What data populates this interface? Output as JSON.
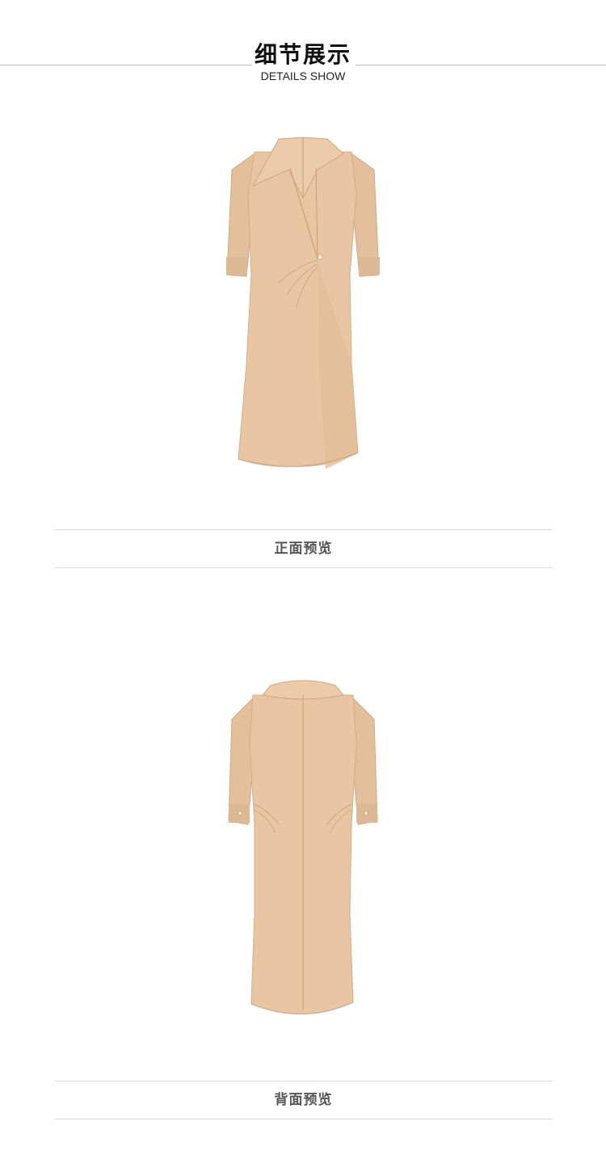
{
  "header": {
    "title": "细节展示",
    "subtitle": "DETAILS SHOW"
  },
  "sections": [
    {
      "image_subject": "dress-front-view",
      "caption": "正面预览"
    },
    {
      "image_subject": "dress-back-view",
      "caption": "背面预览"
    }
  ],
  "colors": {
    "dress_fabric": "#e6c3a0",
    "dress_shadow": "#d2aa85",
    "divider": "#d9d9d9",
    "caption_text": "#555555"
  }
}
